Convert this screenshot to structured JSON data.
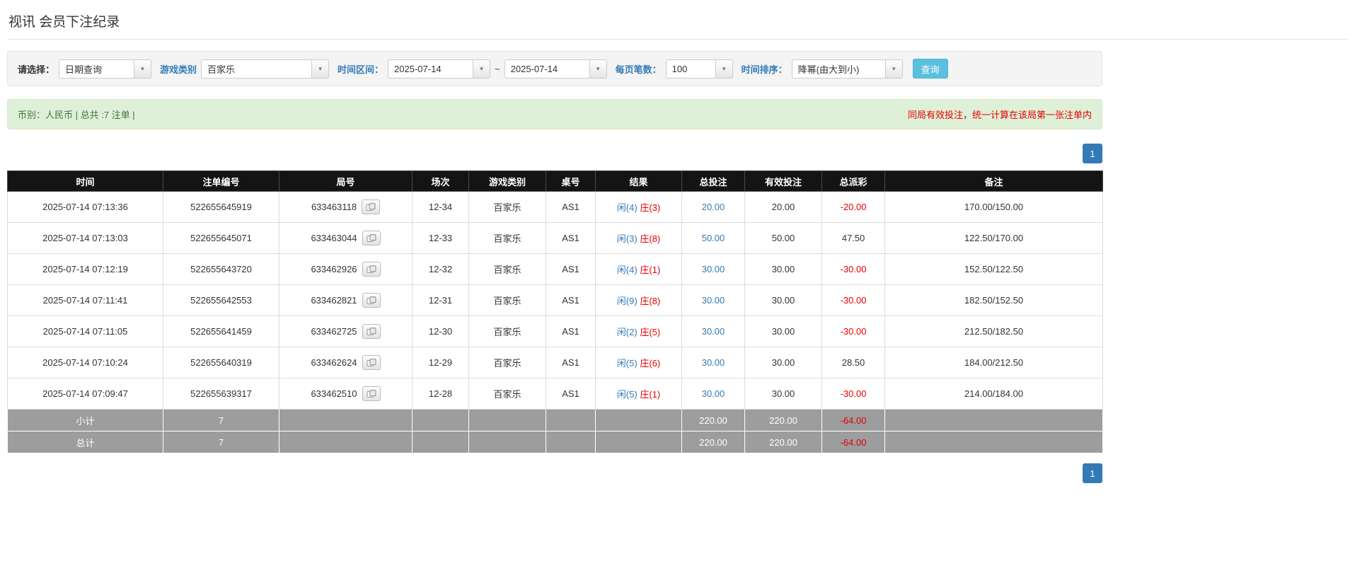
{
  "page": {
    "title": "视讯 会员下注纪录"
  },
  "colors": {
    "accent_blue": "#337ab7",
    "search_button": "#5bc0de",
    "alert_bg": "#dff0d8",
    "alert_text": "#3c763d",
    "warning_red": "#e60000",
    "header_bg": "#141414",
    "summary_row_bg": "#9d9d9d"
  },
  "filters": {
    "select_label": "请选择：",
    "select_value": "日期查询",
    "game_type_label": "游戏类别",
    "game_type_value": "百家乐",
    "time_range_label": "时间区间：",
    "date_from": "2025-07-14",
    "date_separator": "~",
    "date_to": "2025-07-14",
    "page_size_label": "每页笔数：",
    "page_size_value": "100",
    "sort_label": "时间排序：",
    "sort_value": "降幂(由大到小)",
    "search_button": "查询",
    "caret": "▼"
  },
  "summary": {
    "left": "币别：人民币 | 总共 :7 注单 |",
    "right": "同局有效投注，统一计算在该局第一张注单内"
  },
  "pagination": {
    "page": "1"
  },
  "table": {
    "headers": [
      "时间",
      "注单编号",
      "局号",
      "场次",
      "游戏类别",
      "桌号",
      "结果",
      "总投注",
      "有效投注",
      "总派彩",
      "备注"
    ],
    "rows": [
      {
        "time": "2025-07-14 07:13:36",
        "bet_id": "522655645919",
        "round_id": "633463118",
        "session": "12-34",
        "game": "百家乐",
        "table_no": "AS1",
        "result_player": "闲(4)",
        "result_banker": "庄(3)",
        "total_bet": "20.00",
        "valid_bet": "20.00",
        "payout": "-20.00",
        "remark": "170.00/150.00"
      },
      {
        "time": "2025-07-14 07:13:03",
        "bet_id": "522655645071",
        "round_id": "633463044",
        "session": "12-33",
        "game": "百家乐",
        "table_no": "AS1",
        "result_player": "闲(3)",
        "result_banker": "庄(8)",
        "total_bet": "50.00",
        "valid_bet": "50.00",
        "payout": "47.50",
        "remark": "122.50/170.00"
      },
      {
        "time": "2025-07-14 07:12:19",
        "bet_id": "522655643720",
        "round_id": "633462926",
        "session": "12-32",
        "game": "百家乐",
        "table_no": "AS1",
        "result_player": "闲(4)",
        "result_banker": "庄(1)",
        "total_bet": "30.00",
        "valid_bet": "30.00",
        "payout": "-30.00",
        "remark": "152.50/122.50"
      },
      {
        "time": "2025-07-14 07:11:41",
        "bet_id": "522655642553",
        "round_id": "633462821",
        "session": "12-31",
        "game": "百家乐",
        "table_no": "AS1",
        "result_player": "闲(9)",
        "result_banker": "庄(8)",
        "total_bet": "30.00",
        "valid_bet": "30.00",
        "payout": "-30.00",
        "remark": "182.50/152.50"
      },
      {
        "time": "2025-07-14 07:11:05",
        "bet_id": "522655641459",
        "round_id": "633462725",
        "session": "12-30",
        "game": "百家乐",
        "table_no": "AS1",
        "result_player": "闲(2)",
        "result_banker": "庄(5)",
        "total_bet": "30.00",
        "valid_bet": "30.00",
        "payout": "-30.00",
        "remark": "212.50/182.50"
      },
      {
        "time": "2025-07-14 07:10:24",
        "bet_id": "522655640319",
        "round_id": "633462624",
        "session": "12-29",
        "game": "百家乐",
        "table_no": "AS1",
        "result_player": "闲(5)",
        "result_banker": "庄(6)",
        "total_bet": "30.00",
        "valid_bet": "30.00",
        "payout": "28.50",
        "remark": "184.00/212.50"
      },
      {
        "time": "2025-07-14 07:09:47",
        "bet_id": "522655639317",
        "round_id": "633462510",
        "session": "12-28",
        "game": "百家乐",
        "table_no": "AS1",
        "result_player": "闲(5)",
        "result_banker": "庄(1)",
        "total_bet": "30.00",
        "valid_bet": "30.00",
        "payout": "-30.00",
        "remark": "214.00/184.00"
      }
    ],
    "subtotal": {
      "label": "小计",
      "count": "7",
      "total_bet": "220.00",
      "valid_bet": "220.00",
      "payout": "-64.00"
    },
    "total": {
      "label": "总计",
      "count": "7",
      "total_bet": "220.00",
      "valid_bet": "220.00",
      "payout": "-64.00"
    }
  }
}
